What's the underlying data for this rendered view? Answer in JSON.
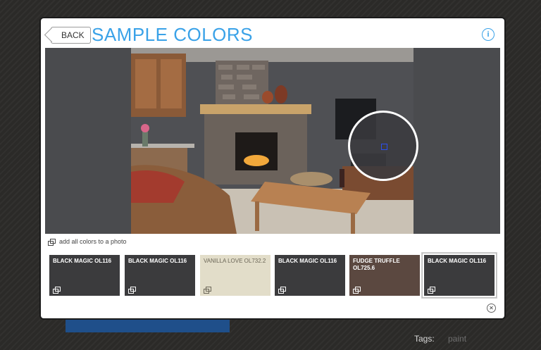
{
  "header": {
    "back_label": "BACK",
    "title": "SAMPLE COLORS",
    "info_icon": "info-icon"
  },
  "photo": {
    "caption": "add all colors to a photo"
  },
  "swatches": [
    {
      "name": "BLACK MAGIC OL116",
      "color": "#3b3b3d",
      "light": false
    },
    {
      "name": "BLACK MAGIC OL116",
      "color": "#3b3b3d",
      "light": false
    },
    {
      "name": "VANILLA LOVE OL732.2",
      "color": "#e2ddc9",
      "light": true
    },
    {
      "name": "BLACK MAGIC OL116",
      "color": "#3b3b3d",
      "light": false
    },
    {
      "name": "FUDGE TRUFFLE OL725.6",
      "color": "#5b4840",
      "light": false
    },
    {
      "name": "BLACK MAGIC OL116",
      "color": "#3b3b3d",
      "light": false,
      "selected": true
    }
  ],
  "colors": {
    "accent": "#3aa2e8",
    "wall": "#4a4b4e"
  }
}
